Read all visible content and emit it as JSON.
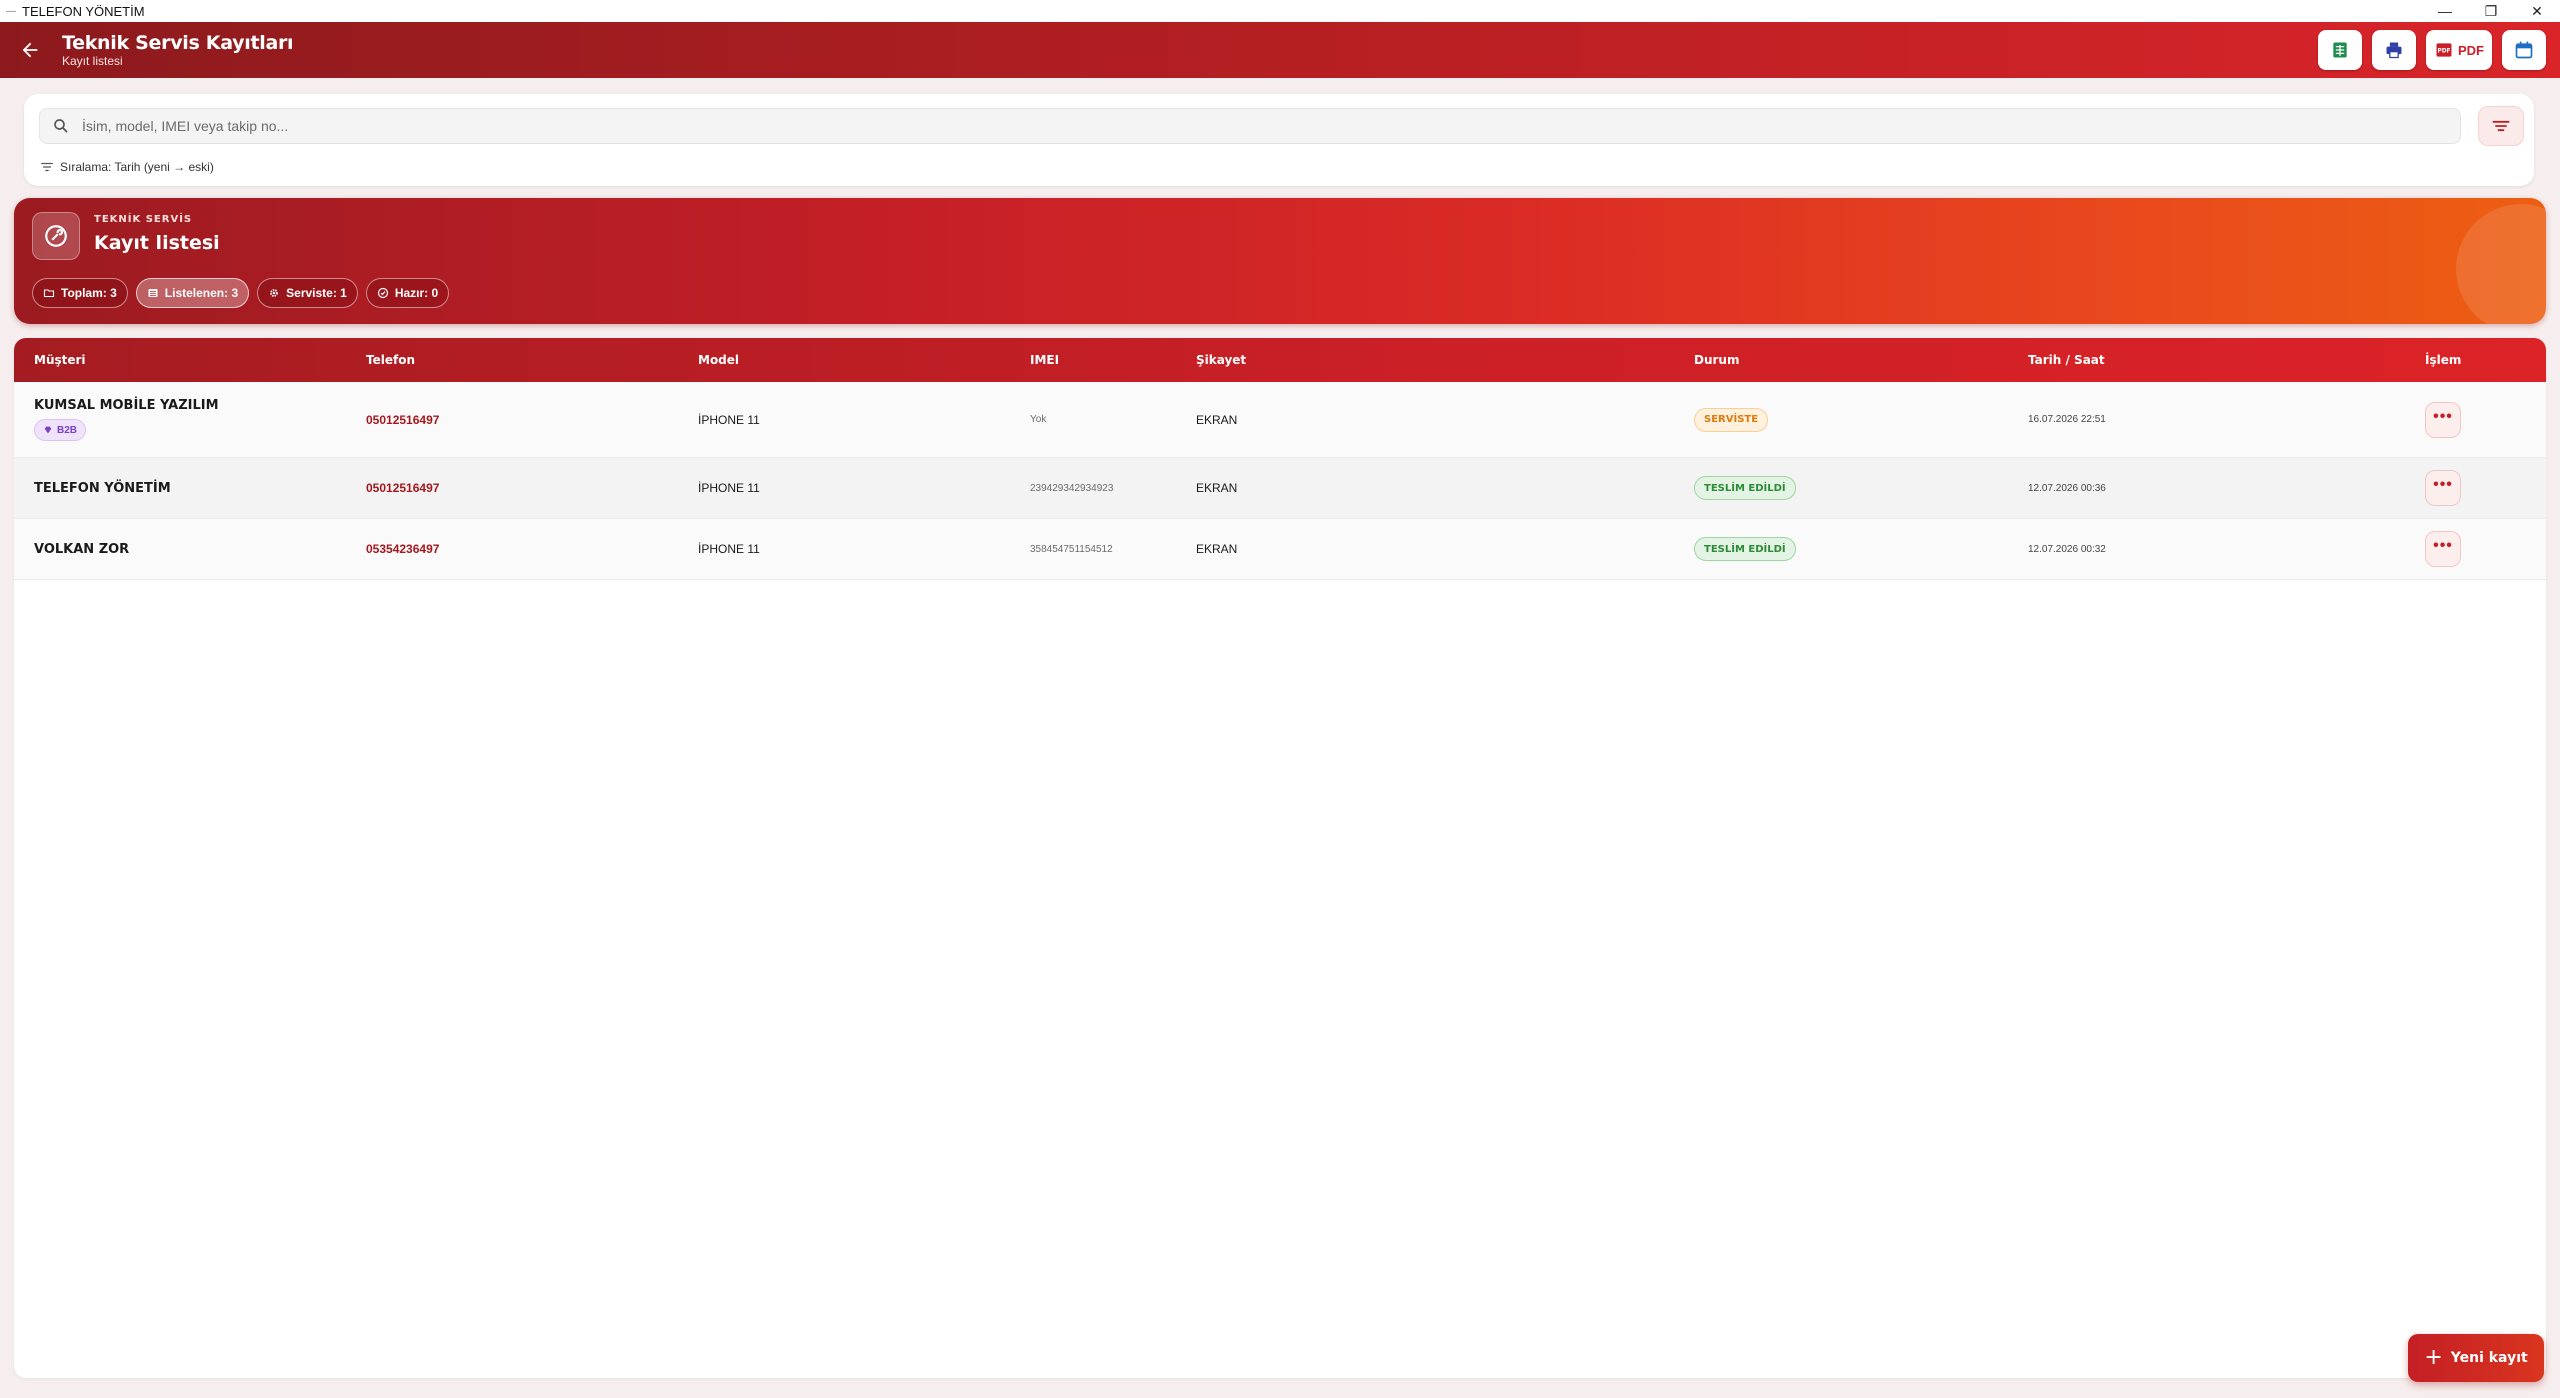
{
  "window": {
    "title": "TELEFON YÖNETİM",
    "controls": [
      "minimize",
      "restore",
      "close"
    ]
  },
  "header": {
    "title": "Teknik Servis Kayıtları",
    "subtitle": "Kayıt listesi",
    "actions": [
      {
        "name": "excel-export",
        "icon": "spreadsheet-icon",
        "color": "#1e8c4e"
      },
      {
        "name": "print",
        "icon": "printer-icon",
        "color": "#2f3fa8"
      },
      {
        "name": "pdf-export",
        "icon": "pdf-icon",
        "label": "PDF",
        "color": "#c8202a"
      },
      {
        "name": "calendar",
        "icon": "calendar-icon",
        "color": "#1e6fc4"
      }
    ]
  },
  "search": {
    "placeholder": "İsim, model, IMEI veya takip no...",
    "value": "",
    "sort_text": "Sıralama: Tarih (yeni → eski)"
  },
  "hero": {
    "kicker": "TEKNİK SERVİS",
    "title": "Kayıt listesi",
    "chips": [
      {
        "icon": "folder-icon",
        "label": "Toplam: 3",
        "active": false
      },
      {
        "icon": "list-icon",
        "label": "Listelenen: 3",
        "active": true
      },
      {
        "icon": "gear-icon",
        "label": "Serviste: 1",
        "active": false
      },
      {
        "icon": "check-circle-icon",
        "label": "Hazır: 0",
        "active": false
      }
    ]
  },
  "table": {
    "columns": [
      "Müşteri",
      "Telefon",
      "Model",
      "IMEI",
      "Şikayet",
      "Durum",
      "Tarih / Saat",
      "İşlem"
    ],
    "rows": [
      {
        "customer": "KUMSAL MOBİLE YAZILIM",
        "badge": "B2B",
        "phone": "05012516497",
        "model": "İPHONE 11",
        "imei": "Yok",
        "complaint": "EKRAN",
        "status": "SERVİSTE",
        "status_type": "service",
        "datetime": "16.07.2026 22:51"
      },
      {
        "customer": "TELEFON YÖNETİM",
        "badge": "",
        "phone": "05012516497",
        "model": "İPHONE 11",
        "imei": "239429342934923",
        "complaint": "EKRAN",
        "status": "TESLİM EDİLDİ",
        "status_type": "delivered",
        "datetime": "12.07.2026 00:36"
      },
      {
        "customer": "VOLKAN ZOR",
        "badge": "",
        "phone": "05354236497",
        "model": "İPHONE 11",
        "imei": "358454751154512",
        "complaint": "EKRAN",
        "status": "TESLİM EDİLDİ",
        "status_type": "delivered",
        "datetime": "12.07.2026 00:32"
      }
    ],
    "action_icon": "more-horizontal-icon"
  },
  "fab": {
    "icon": "plus-icon",
    "label": "Yeni kayıt"
  },
  "colors": {
    "brand_dark": "#8c1a1d",
    "brand": "#c81f26",
    "accent_orange": "#ec5f12",
    "service": "#e07a0a",
    "delivered": "#2d8a36",
    "b2b": "#7b3fc4"
  }
}
